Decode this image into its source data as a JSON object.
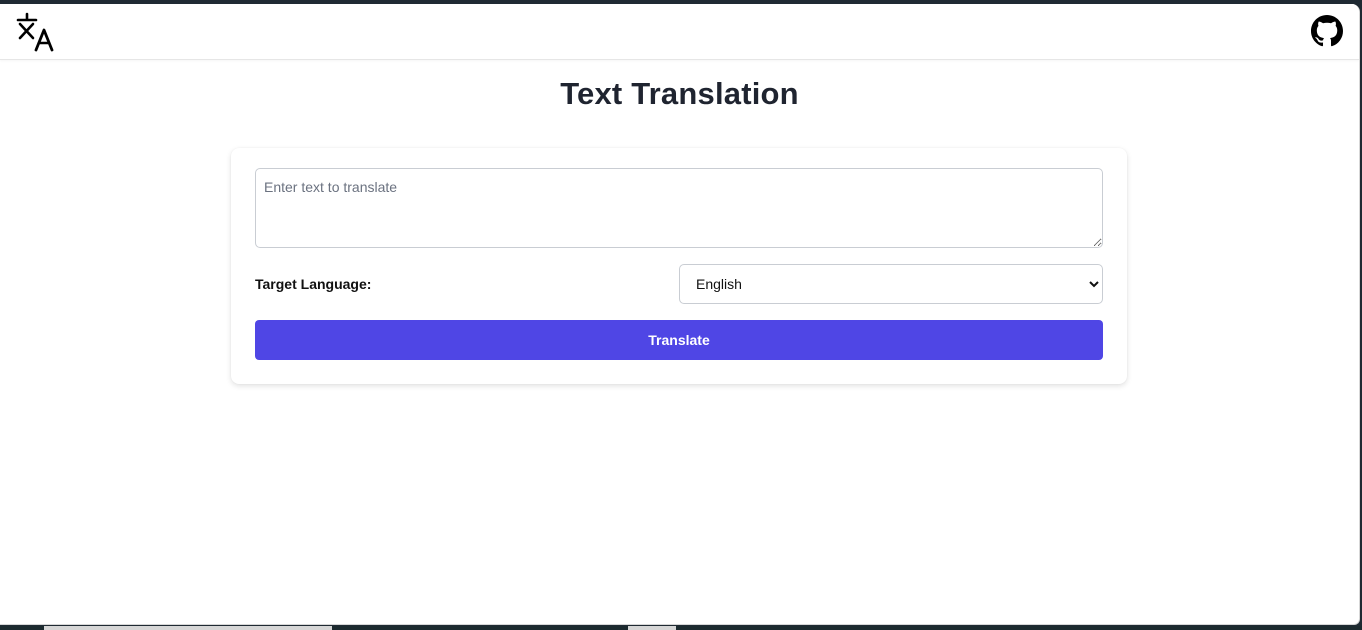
{
  "navbar": {
    "logo_icon": "translate-icon",
    "github_icon": "github-icon"
  },
  "page": {
    "title": "Text Translation"
  },
  "form": {
    "text_input": {
      "value": "",
      "placeholder": "Enter text to translate"
    },
    "target_language": {
      "label": "Target Language:",
      "selected": "English"
    },
    "translate_button": "Translate"
  },
  "colors": {
    "accent": "#4f46e5",
    "title": "#1f2430"
  }
}
